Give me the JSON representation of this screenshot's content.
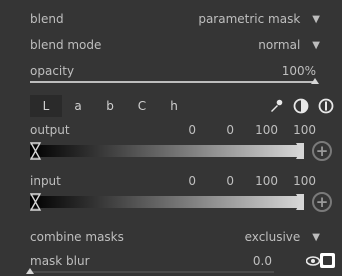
{
  "blend": {
    "label": "blend",
    "value": "parametric mask"
  },
  "blend_mode": {
    "label": "blend mode",
    "value": "normal"
  },
  "opacity": {
    "label": "opacity",
    "value": "100%",
    "level": 1.0
  },
  "channels": {
    "tabs": [
      "L",
      "a",
      "b",
      "C",
      "h"
    ],
    "active": "L"
  },
  "toolbar": {
    "icons": [
      "color-picker-icon",
      "invert-icon",
      "reset-icon"
    ]
  },
  "output": {
    "label": "output",
    "v1": "0",
    "v2": "0",
    "v3": "100",
    "v4": "100"
  },
  "input": {
    "label": "input",
    "v1": "0",
    "v2": "0",
    "v3": "100",
    "v4": "100"
  },
  "combine_masks": {
    "label": "combine masks",
    "value": "exclusive"
  },
  "mask_blur": {
    "label": "mask blur",
    "value": "0.0",
    "level": 0.0
  },
  "colors": {
    "panel": "#353535",
    "text": "#bfbfbf",
    "active_tab": "#2a2a2a"
  }
}
